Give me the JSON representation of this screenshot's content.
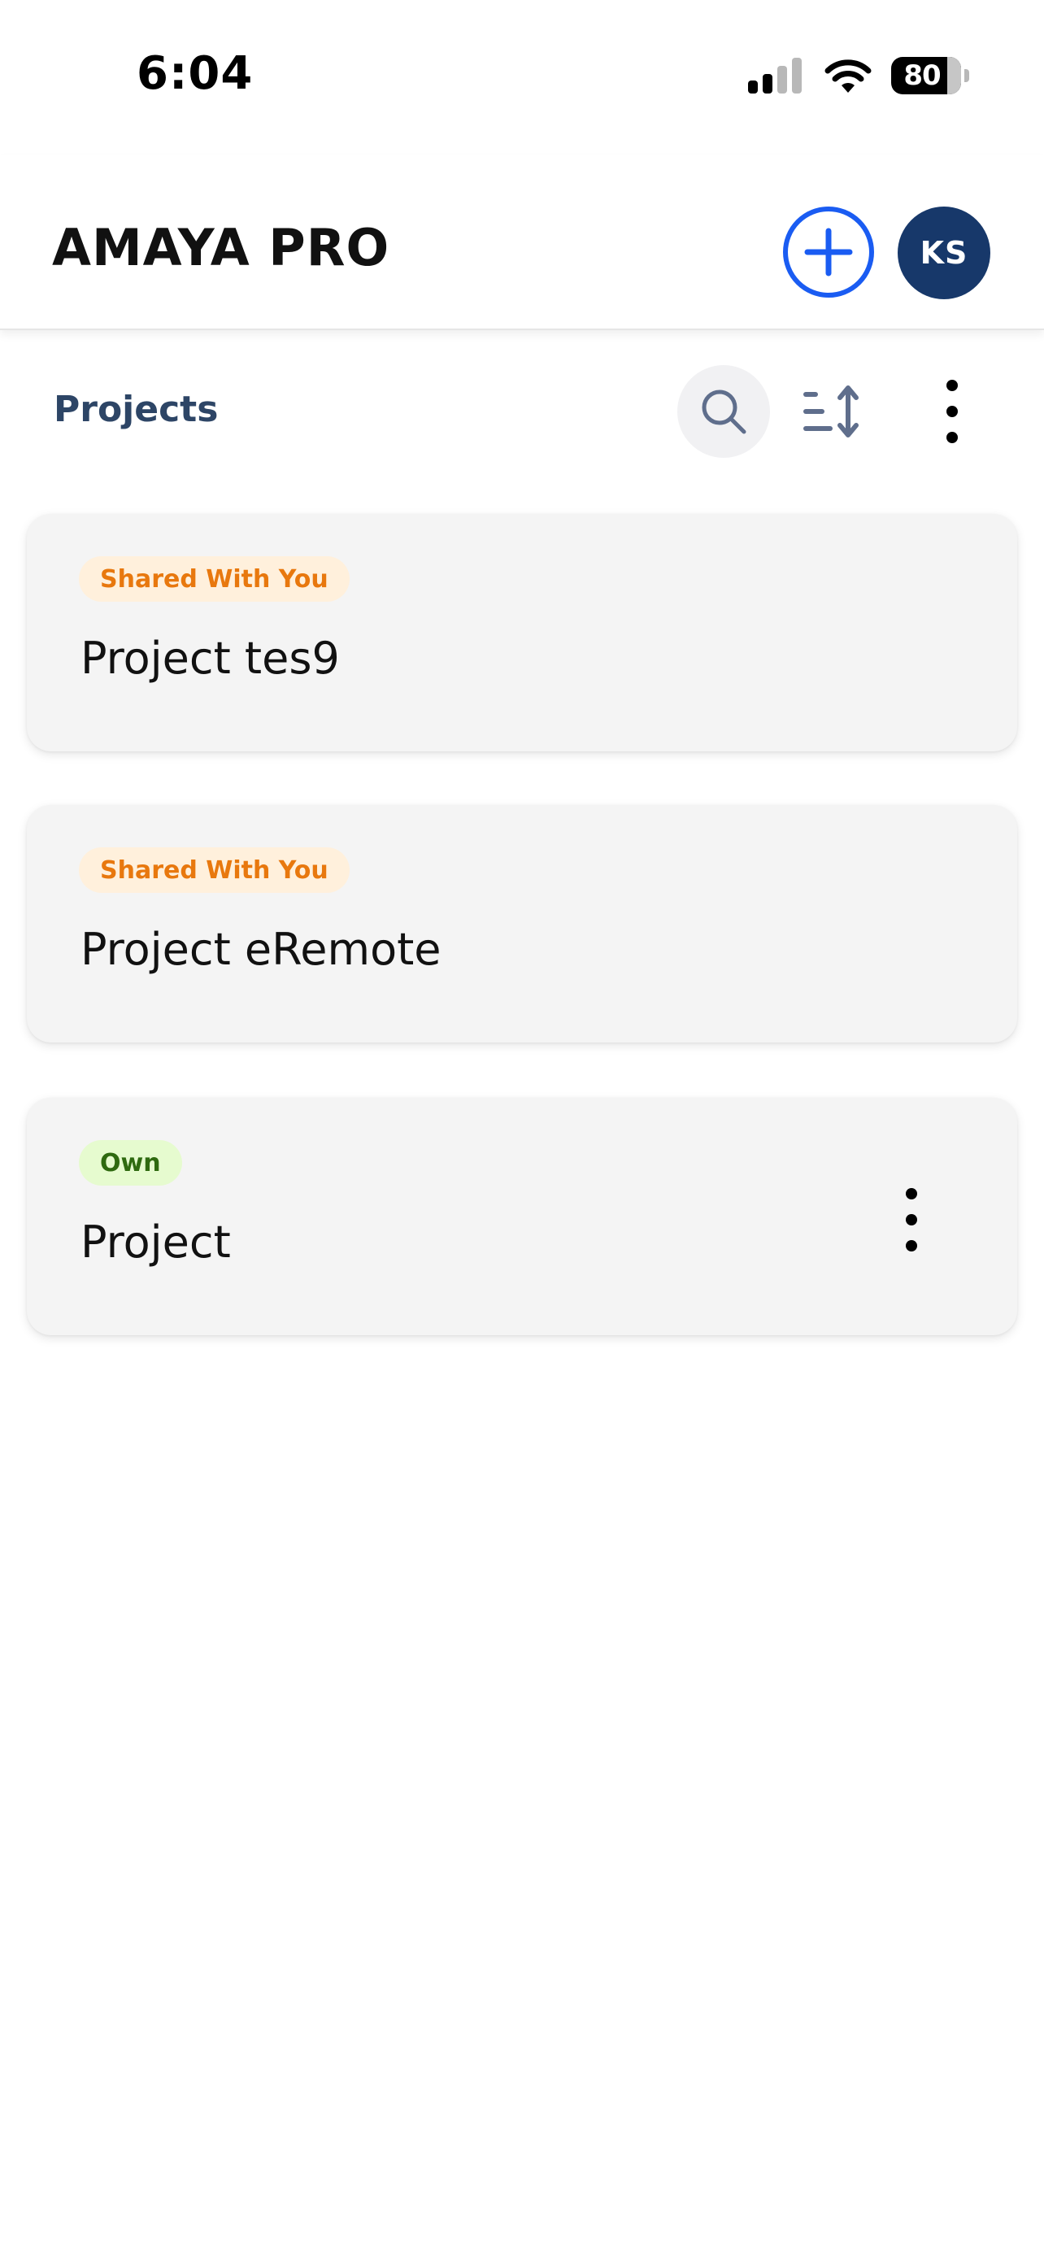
{
  "status_bar": {
    "time": "6:04",
    "battery_level": "80"
  },
  "header": {
    "brand": "AMAYA PRO",
    "avatar_initials": "KS",
    "accent_color": "#1a5cf2",
    "avatar_color": "#17386a"
  },
  "toolbar": {
    "title": "Projects",
    "icons": [
      "search-icon",
      "sort-icon",
      "more-vertical-icon"
    ]
  },
  "projects": [
    {
      "badge": "Shared With You",
      "name": "Project tes9"
    },
    {
      "badge": "Shared With You",
      "name": "Project eRemote"
    },
    {
      "badge": "Own",
      "name": "Project"
    }
  ],
  "badge_colors": {
    "shared_bg": "#fff0dc",
    "shared_text": "#e8780e",
    "own_bg": "#e6fbcf",
    "own_text": "#2f6a10"
  }
}
